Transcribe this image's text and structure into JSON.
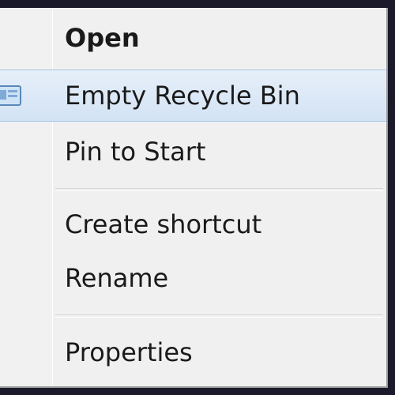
{
  "context_menu": {
    "items": [
      {
        "label": "Open",
        "bold": true
      },
      {
        "label": "Empty Recycle Bin",
        "highlighted": true,
        "icon": "recycle-bin-icon"
      },
      {
        "label": "Pin to Start"
      },
      {
        "label": "Create shortcut"
      },
      {
        "label": "Rename"
      },
      {
        "label": "Properties"
      }
    ]
  },
  "colors": {
    "menu_background": "#f0f0f0",
    "highlight_background": "#dae7f6",
    "highlight_border": "#a9c6e8",
    "text": "#1a1a1a"
  }
}
